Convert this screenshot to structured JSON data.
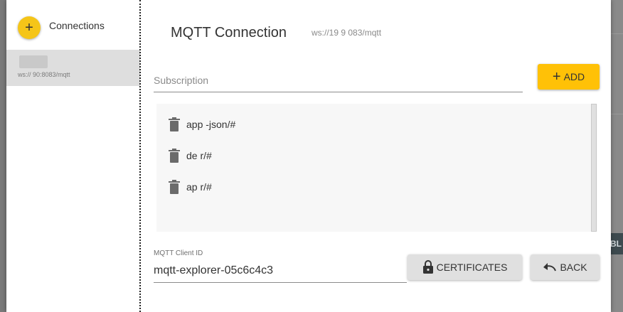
{
  "background": {
    "edge_label": "BL"
  },
  "sidebar": {
    "add_icon": "plus-icon",
    "title": "Connections",
    "connection": {
      "url": "ws://        90:8083/mqtt"
    }
  },
  "main": {
    "title": "MQTT Connection",
    "url": "ws://19            9    083/mqtt"
  },
  "subscription": {
    "placeholder": "Subscription",
    "add_label": "ADD",
    "add_icon": "plus-icon",
    "items": [
      {
        "topic": "app       -json/#",
        "icon": "trash-icon"
      },
      {
        "topic": "de       r/#",
        "icon": "trash-icon"
      },
      {
        "topic": "ap       r/#",
        "icon": "trash-icon"
      }
    ]
  },
  "client": {
    "label": "MQTT Client ID",
    "value": "mqtt-explorer-05c6c4c3"
  },
  "buttons": {
    "certificates": "CERTIFICATES",
    "certificates_icon": "lock-icon",
    "back": "BACK",
    "back_icon": "undo-icon"
  },
  "colors": {
    "accent": "#ffc107",
    "fab": "#f5c518",
    "selected_row": "#dedede",
    "list_bg": "#f7f7f7"
  }
}
